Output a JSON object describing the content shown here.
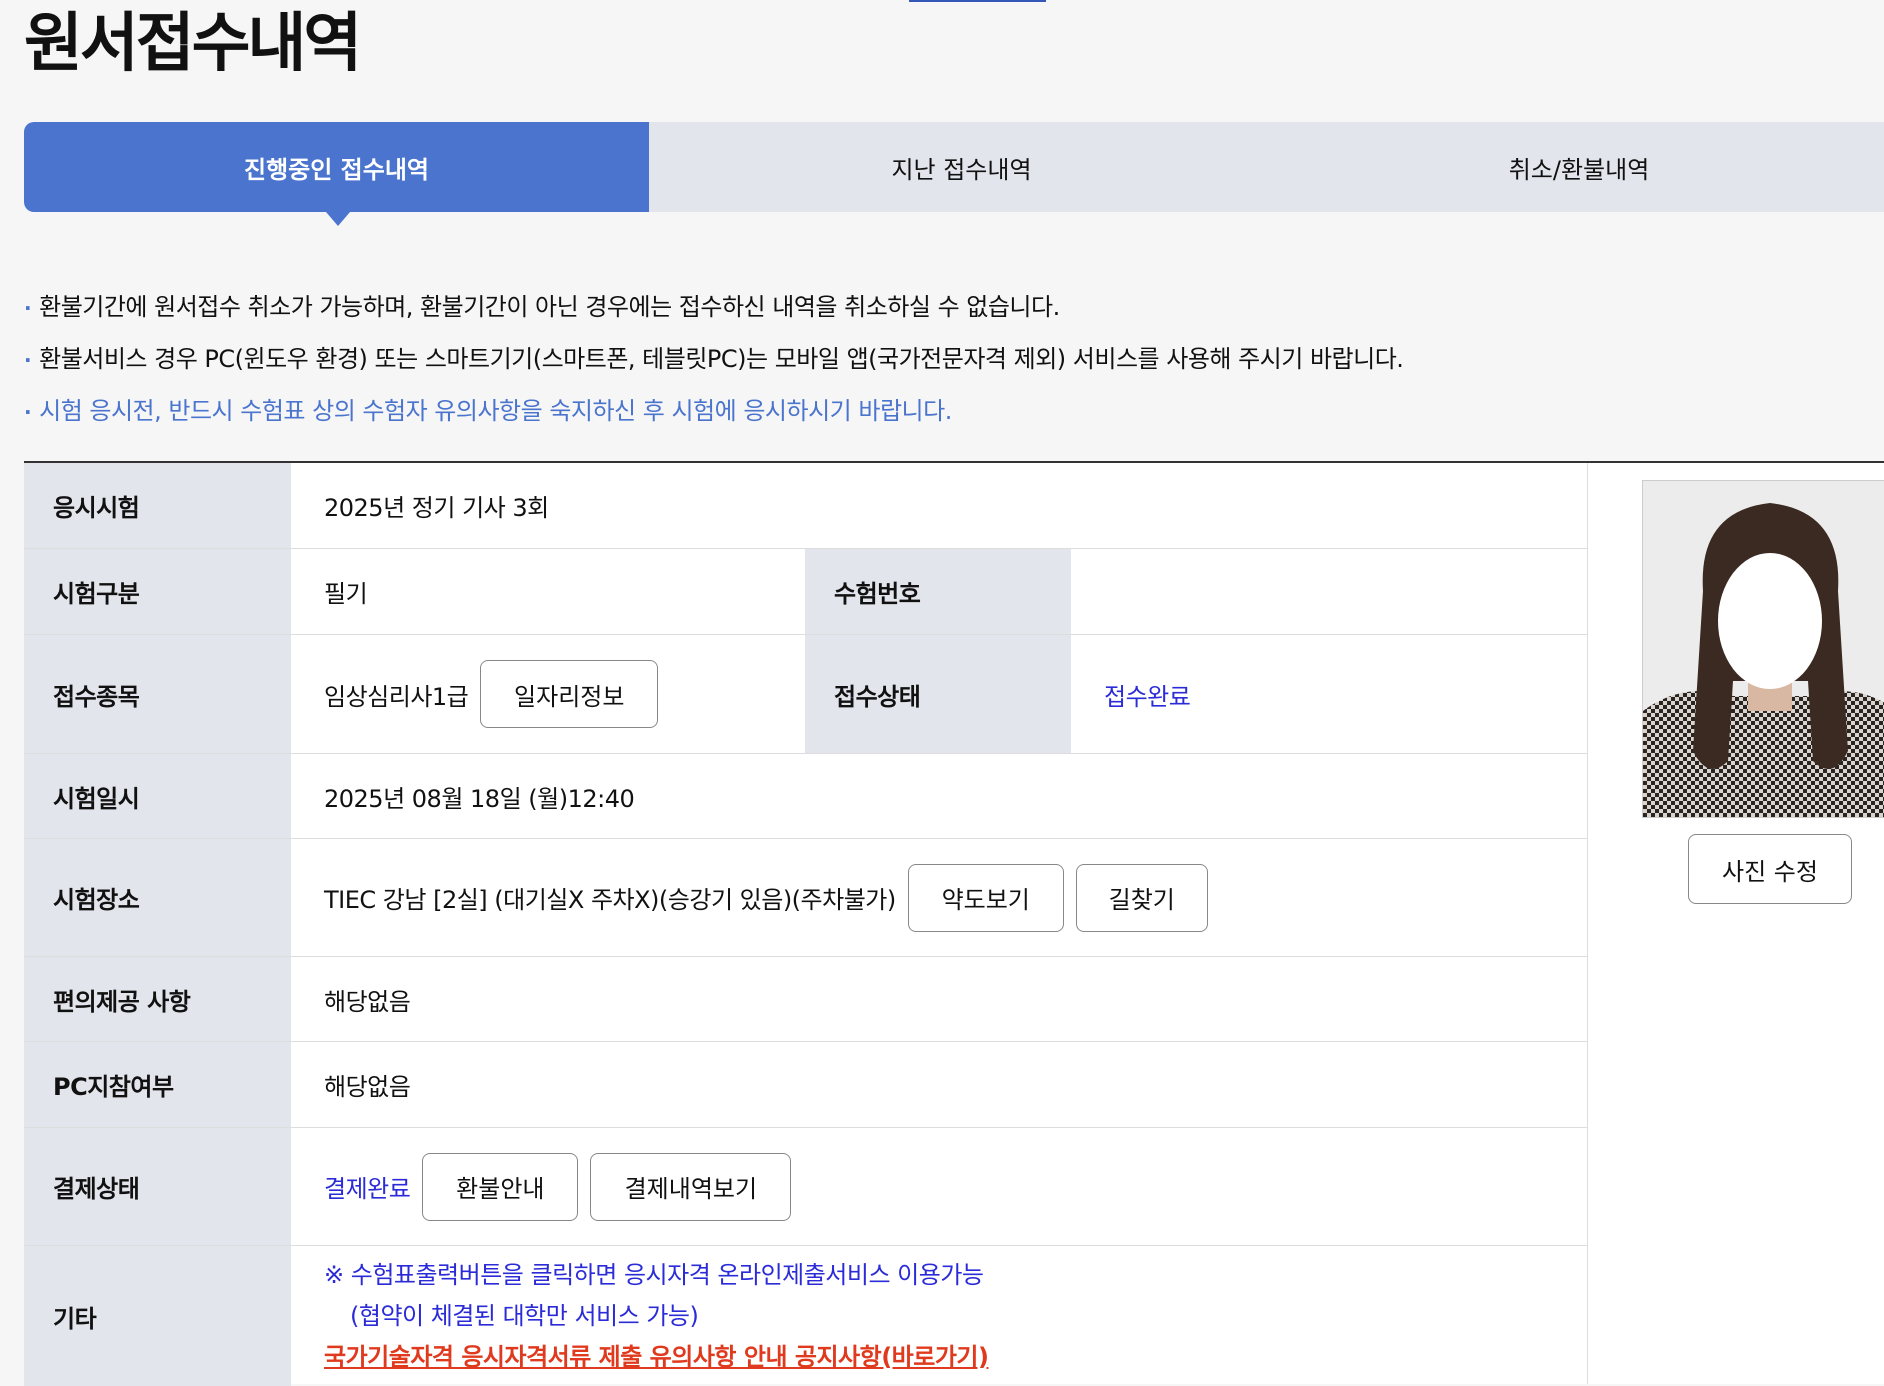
{
  "page": {
    "title": "원서접수내역"
  },
  "tabs": [
    {
      "label": "진행중인 접수내역",
      "active": true
    },
    {
      "label": "지난 접수내역",
      "active": false
    },
    {
      "label": "취소/환불내역",
      "active": false
    }
  ],
  "notices": [
    {
      "text": "환불기간에 원서접수 취소가 가능하며, 환불기간이 아닌 경우에는 접수하신 내역을 취소하실 수 없습니다."
    },
    {
      "text": "환불서비스 경우 PC(윈도우 환경) 또는 스마트기기(스마트폰, 테블릿PC)는 모바일 앱(국가전문자격 제외) 서비스를 사용해 주시기 바랍니다."
    },
    {
      "text": "시험 응시전, 반드시 수험표 상의 수험자 유의사항을 숙지하신 후 시험에 응시하시기 바랍니다."
    }
  ],
  "exam": {
    "exam_label": "응시시험",
    "exam_value": "2025년 정기 기사 3회",
    "type_label": "시험구분",
    "type_value": "필기",
    "number_label": "수험번호",
    "number_value": "",
    "item_label": "접수종목",
    "item_value": "임상심리사1급",
    "job_button": "일자리정보",
    "status_label": "접수상태",
    "status_value": "접수완료",
    "date_label": "시험일시",
    "date_value": "2025년 08월 18일 (월)12:40",
    "place_label": "시험장소",
    "place_value": "TIEC 강남 [2실] (대기실X 주차X)(승강기 있음)(주차불가)",
    "map_button": "약도보기",
    "route_button": "길찾기",
    "convenience_label": "편의제공 사항",
    "convenience_value": "해당없음",
    "pc_label": "PC지참여부",
    "pc_value": "해당없음",
    "payment_label": "결제상태",
    "payment_value": "결제완료",
    "refund_button": "환불안내",
    "payment_history_button": "결제내역보기",
    "etc_label": "기타",
    "etc_line1": "※ 수험표출력버튼을 클릭하면 응시자격 온라인제출서비스 이용가능",
    "etc_line2": "(협약이 체결된 대학만 서비스 가능)",
    "etc_link": "국가기술자격 응시자격서류 제출 유의사항 안내 공지사항(바로가기)"
  },
  "photo": {
    "edit_button": "사진 수정"
  },
  "colors": {
    "accent": "#4a74cd",
    "link_blue": "#2b2bd8",
    "warning_red": "#e03a1e",
    "header_bg": "#e3e5ec"
  }
}
